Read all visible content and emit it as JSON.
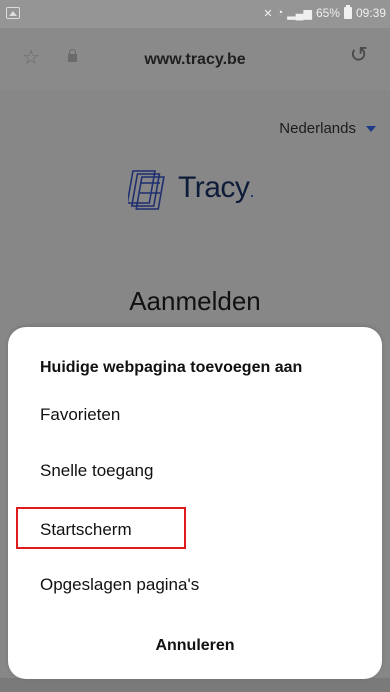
{
  "status_bar": {
    "battery": "65%",
    "time": "09:39",
    "icons": [
      "gallery-icon",
      "mute-icon",
      "wifi-icon",
      "signal-icon",
      "battery-icon"
    ]
  },
  "browser": {
    "url": "www.tracy.be",
    "icons": [
      "star-icon",
      "lock-icon",
      "reload-icon"
    ]
  },
  "page": {
    "language": "Nederlands",
    "logo_text": "Tracy",
    "title": "Aanmelden"
  },
  "sheet": {
    "title": "Huidige webpagina toevoegen aan",
    "options": [
      "Favorieten",
      "Snelle toegang",
      "Startscherm",
      "Opgeslagen pagina's"
    ],
    "cancel": "Annuleren",
    "highlight_color": "#e01b1b"
  }
}
